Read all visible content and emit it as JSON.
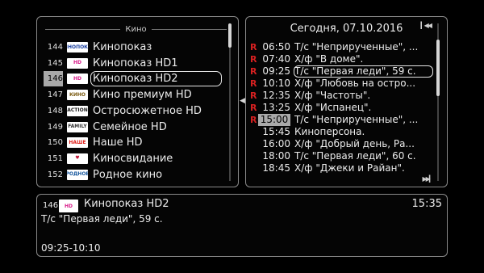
{
  "channels": {
    "group_title": "Кино",
    "items": [
      {
        "num": "144",
        "name": "Кинопоказ",
        "logo": "КИНОПОКАЗ",
        "logo_color": "#1a3fa0"
      },
      {
        "num": "145",
        "name": "Кинопоказ HD1",
        "logo": "HD",
        "logo_color": "#d81b8a"
      },
      {
        "num": "146",
        "name": "Кинопоказ HD2",
        "logo": "HD",
        "logo_color": "#d81b8a",
        "selected": true
      },
      {
        "num": "147",
        "name": "Кино премиум HD",
        "logo": "КИНО",
        "logo_color": "#7a5a10"
      },
      {
        "num": "148",
        "name": "Остросюжетное HD",
        "logo": "ACTION",
        "logo_color": "#222222"
      },
      {
        "num": "149",
        "name": "Семейное HD",
        "logo": "FAMILY",
        "logo_color": "#333333"
      },
      {
        "num": "150",
        "name": "Наше HD",
        "logo": "НАШЕ",
        "logo_color": "#e0201a"
      },
      {
        "num": "151",
        "name": "Киносвидание",
        "logo": "♥",
        "logo_color": "#c01a3a"
      },
      {
        "num": "152",
        "name": "Родное кино",
        "logo": "РОДНОЕ",
        "logo_color": "#1a5aa0"
      }
    ]
  },
  "epg": {
    "date": "Сегодня, 07.10.2016",
    "items": [
      {
        "rec": "R",
        "time": "06:50",
        "title": "Т/с \"Неприрученные\", ..."
      },
      {
        "rec": "R",
        "time": "07:40",
        "title": "Х/ф \"В доме\"."
      },
      {
        "rec": "R",
        "time": "09:25",
        "title": "Т/с \"Первая леди\", 59 с.",
        "selected": true
      },
      {
        "rec": "R",
        "time": "10:10",
        "title": "Х/ф \"Любовь на остро..."
      },
      {
        "rec": "R",
        "time": "12:35",
        "title": "Х/ф \"Частоты\"."
      },
      {
        "rec": "R",
        "time": "13:25",
        "title": "Х/ф \"Испанец\"."
      },
      {
        "rec": "R",
        "time": "15:00",
        "title": "Т/с \"Неприрученные\", ...",
        "now": true
      },
      {
        "rec": "",
        "time": "15:45",
        "title": "Киноперсона."
      },
      {
        "rec": "",
        "time": "16:00",
        "title": "Х/ф \"Добрый день, Ра..."
      },
      {
        "rec": "",
        "time": "18:00",
        "title": "Т/с \"Первая леди\", 60 с."
      },
      {
        "rec": "",
        "time": "18:45",
        "title": "Х/ф \"Джеки и Райан\"."
      }
    ]
  },
  "info": {
    "num": "146",
    "logo": "HD",
    "channel": "Кинопоказ HD2",
    "clock": "15:35",
    "program": "Т/с \"Первая леди\", 59 с.",
    "range": "09:25-10:10"
  },
  "colors": {
    "record_marker": "#d42020",
    "selection_bg": "#a9a9a9"
  },
  "icons": {
    "epg_top": "skip-back-icon",
    "epg_bottom": "skip-forward-icon",
    "middle": "left-arrow-icon"
  }
}
